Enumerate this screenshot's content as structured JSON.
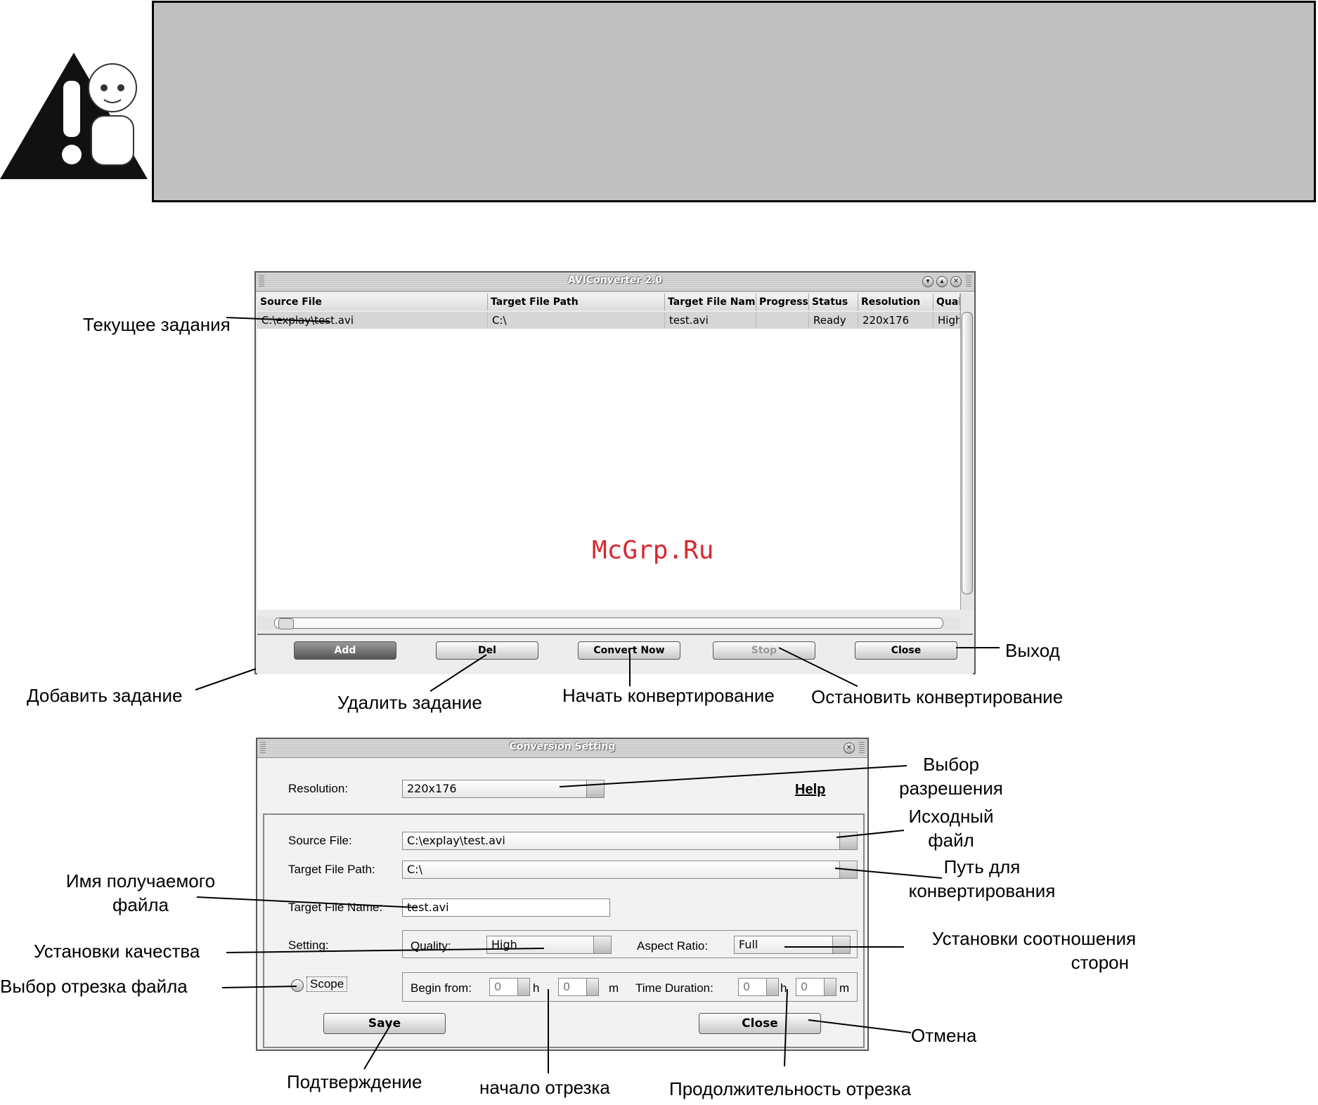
{
  "main_window": {
    "title": "AVIConverter 2.0",
    "columns": [
      "Source File",
      "Target File Path",
      "Target File Name",
      "Progress",
      "Status",
      "Resolution",
      "Qual"
    ],
    "rows": [
      {
        "source": "C:\\explay\\test.avi",
        "path": "C:\\",
        "name": "test.avi",
        "progress": "",
        "status": "Ready",
        "resolution": "220x176",
        "quality": "High"
      }
    ],
    "buttons": {
      "add": "Add",
      "del": "Del",
      "convert": "Convert Now",
      "stop": "Stop",
      "close": "Close"
    }
  },
  "settings_window": {
    "title": "Conversion Setting",
    "resolution_label": "Resolution:",
    "resolution_value": "220x176",
    "help": "Help",
    "source_label": "Source File:",
    "source_value": "C:\\explay\\test.avi",
    "path_label": "Target File Path:",
    "path_value": "C:\\",
    "name_label": "Target File Name:",
    "name_value": "test.avi",
    "setting_label": "Setting:",
    "quality_label": "Quality:",
    "quality_value": "High",
    "aspect_label": "Aspect Ratio:",
    "aspect_value": "Full",
    "scope_label": "Scope",
    "begin_label": "Begin from:",
    "begin_h": "0",
    "h_unit": "h",
    "begin_m": "0",
    "m_unit": "m",
    "duration_label": "Time Duration:",
    "dur_h": "0",
    "dur_m": "0",
    "save": "Save",
    "close": "Close"
  },
  "annotations": {
    "current_task": "Текущее задания",
    "add_task": "Добавить задание",
    "delete_task": "Удалить задание",
    "start_convert": "Начать конвертирование",
    "stop_convert": "Остановить конвертирование",
    "exit": "Выход",
    "res_choice_1": "Выбор",
    "res_choice_2": "разрешения",
    "source_1": "Исходный",
    "source_2": "файл",
    "path_1": "Путь для",
    "path_2": "конвертирования",
    "name_1": "Имя получаемого",
    "name_2": "файла",
    "quality": "Установки качества",
    "aspect_1": "Установки соотношения",
    "aspect_2": "сторон",
    "scope": "Выбор отрезка файла",
    "cancel": "Отмена",
    "confirm": "Подтверждение",
    "begin": "начало отрезка",
    "duration": "Продолжительность отрезка"
  },
  "watermark": "McGrp.Ru"
}
